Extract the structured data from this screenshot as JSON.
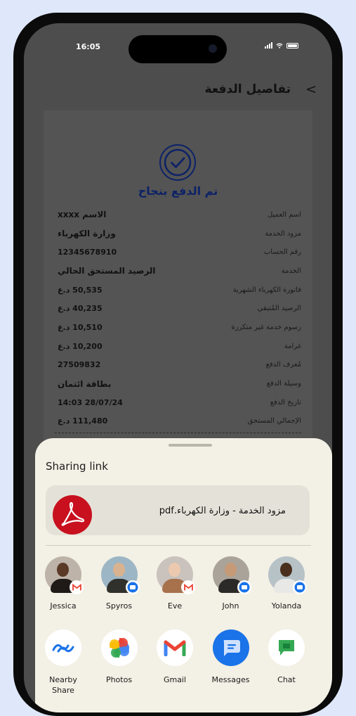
{
  "status_bar": {
    "time": "16:05"
  },
  "header": {
    "title": "تفاصيل الدفعة",
    "back_icon": "chevron-right"
  },
  "receipt": {
    "success_icon": "check-circle-icon",
    "success_text": "تم الدفع بنجاح",
    "rows": [
      {
        "label": "اسم العميل",
        "value": "الاسم xxxx"
      },
      {
        "label": "مزود الخدمة",
        "value": "وزارة الكهرباء"
      },
      {
        "label": "رقم الحساب",
        "value": "12345678910"
      },
      {
        "label": "الخدمة",
        "value": "الرصيد المستحق الحالي"
      },
      {
        "label": "فاتورة الكهرباء الشهرية",
        "value": "50,535 د.ع"
      },
      {
        "label": "الرصيد المُتبقي",
        "value": "40,235 د.ع"
      },
      {
        "label": "رسوم خدمة غير متكررة",
        "value": "10,510 د.ع"
      },
      {
        "label": "غرامة",
        "value": "10,200 د.ع"
      },
      {
        "label": "مُعرف الدفع",
        "value": "27509832"
      },
      {
        "label": "وسيلة الدفع",
        "value": "بطاقة ائتمان"
      },
      {
        "label": "تاريخ الدفع",
        "value": "28/07/24 14:03"
      },
      {
        "label": "الإجمالي المستحق",
        "value": "111,480 د.ع"
      }
    ]
  },
  "share_sheet": {
    "title": "Sharing link",
    "file_name": "مزود الخدمة - وزارة الكهرباء.pdf",
    "file_icon": "pdf-icon",
    "contacts": [
      {
        "name": "Jessica",
        "badge": "gmail"
      },
      {
        "name": "Spyros",
        "badge": "messages"
      },
      {
        "name": "Eve",
        "badge": "gmail"
      },
      {
        "name": "John",
        "badge": "messages"
      },
      {
        "name": "Yolanda",
        "badge": "messages"
      }
    ],
    "apps": [
      {
        "label": "Nearby Share",
        "icon": "nearby-share-icon"
      },
      {
        "label": "Photos",
        "icon": "photos-icon"
      },
      {
        "label": "Gmail",
        "icon": "gmail-icon"
      },
      {
        "label": "Messages",
        "icon": "messages-icon"
      },
      {
        "label": "Chat",
        "icon": "chat-icon"
      }
    ]
  },
  "colors": {
    "background": "#dfe8fb",
    "sheet": "#f3f0e5",
    "accent_navy": "#0d2266",
    "pdf_red": "#c8101e",
    "messages_blue": "#1a73e8"
  }
}
